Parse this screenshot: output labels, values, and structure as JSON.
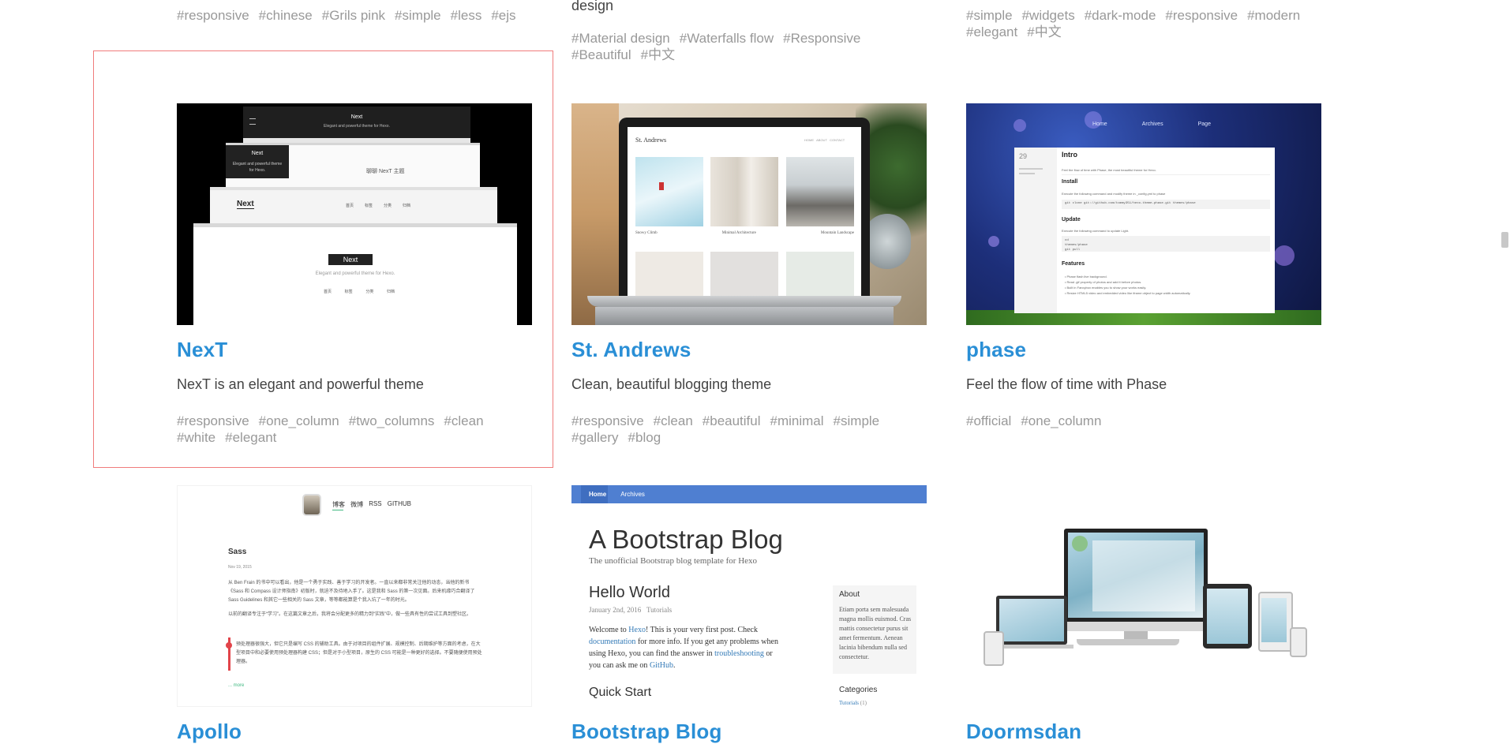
{
  "top_row": {
    "col1_tags": [
      "#responsive",
      "#chinese",
      "#Grils pink",
      "#simple",
      "#less",
      "#ejs"
    ],
    "col2_desc_tail": "design",
    "col2_tags_line1": [
      "#Material design",
      "#Waterfalls flow",
      "#Responsive"
    ],
    "col2_tags_line2": [
      "#Beautiful",
      "#中文"
    ],
    "col3_tags_line1": [
      "#simple",
      "#widgets",
      "#dark-mode",
      "#responsive",
      "#modern"
    ],
    "col3_tags_line2": [
      "#elegant",
      "#中文"
    ]
  },
  "cards": [
    {
      "title": "NexT",
      "desc": "NexT is an elegant and powerful theme",
      "tags_line1": [
        "#responsive",
        "#one_column",
        "#two_columns",
        "#clean"
      ],
      "tags_line2": [
        "#white",
        "#elegant"
      ],
      "shot": {
        "top_title": "Next",
        "top_sub": "Elegant and powerful theme for Hexo.",
        "mid_title": "Next",
        "mid_sub": "Elegant and powerful theme for Hexo.",
        "mid_cn": "聊聊 NexT 主题",
        "nav_logo": "Next",
        "nav_items": [
          "首页",
          "标签",
          "分类",
          "归档"
        ],
        "front_title": "Next",
        "front_sub": "Elegant and powerful theme for Hexo.",
        "front_nav": [
          "首页",
          "标签",
          "分类",
          "归档"
        ]
      }
    },
    {
      "title": "St. Andrews",
      "desc": "Clean, beautiful blogging theme",
      "tags_line1": [
        "#responsive",
        "#clean",
        "#beautiful",
        "#minimal",
        "#simple"
      ],
      "tags_line2": [
        "#gallery",
        "#blog"
      ],
      "shot": {
        "site": "St. Andrews",
        "nav": "HOME   ABOUT   CONTACT",
        "captions": [
          "Snowy Climb",
          "Minimal Architecture",
          "Mountain Landscape"
        ]
      }
    },
    {
      "title": "phase",
      "desc": "Feel the flow of time with Phase",
      "tags_line1": [
        "#official",
        "#one_column"
      ],
      "tags_line2": [],
      "shot": {
        "nav": [
          "Home",
          "Archives",
          "Page"
        ],
        "date": "29",
        "h_intro": "Intro",
        "intro_text": "Feel the flow of time with Phase, the most beautiful theme for Hexo.",
        "h_install": "Install",
        "install_text": "Execute the following command and modify theme in _config.yml to phase",
        "install_cmd": "git clone git://github.com/tommy351/hexo-theme-phase.git themes/phase",
        "h_update": "Update",
        "update_text": "Execute the following command to update Light.",
        "update_cmd": "cd themes/phase  git pull",
        "h_features": "Features",
        "features": [
          "Phase flash live background.",
          "Read .gif property of photos and add it before photos.",
          "Built in Fancybox enables you to show your works easily.",
          "Resize HTML5 video and embedded video like iframe object to page width automatically."
        ]
      }
    }
  ],
  "bottom": [
    {
      "title": "Apollo",
      "shot": {
        "nav": [
          "博客",
          "微博",
          "RSS",
          "GITHUB"
        ],
        "post_title": "Sass",
        "post_date": "Nov 19, 2015",
        "p1": "从 Ben Frain 的书中可以看出，他是一个勇于实践、善于学习的开发者。一直以来都非常关注他的动态，当他的新书《Sass 和 Compass 设计师指南》初版时，就迫不及待地入手了。这是我和 Sass 的第一次见面。后来机缘巧合翻译了 Sass Guidelines 和其它一些相关的 Sass 文章，等等都能算是个我入坑了一年的时光。",
        "p2": "以前的翻译专注于“学习”。在这篇文章之后，我将会分配更多的精力到“实践”中，做一些具有性的尝试工具到塑社区。",
        "quote": "预处理器很强大，但它只是编写 CSS 的辅助工具。由于对项目的组件扩展、规模控制、后期维护等方面的考虑，在大型项目中和必要使用预处理器构建 CSS；但是对于小型项目，原生的 CSS 可能是一种更好的选择。不要随便使用预处理器。",
        "more": "... more"
      }
    },
    {
      "title": "Bootstrap Blog",
      "shot": {
        "nav": [
          "Home",
          "Archives"
        ],
        "blog_title": "A Bootstrap Blog",
        "blog_sub": "The unofficial Bootstrap blog template for Hexo",
        "post_title": "Hello World",
        "post_date": "January 2nd, 2016",
        "post_cat": "Tutorials",
        "text1": "Welcome to",
        "text_link1": "Hexo",
        "text2": "! This is your very first post. Check",
        "text_link2": "documentation",
        "text3": "for more info. If you get any problems when using Hexo, you can find the answer in",
        "text_link3": "troubleshooting",
        "text4": "or you can ask me on",
        "text_link4": "GitHub",
        "h2": "Quick Start",
        "about_title": "About",
        "about_text": "Etiam porta sem malesuada magna mollis euismod. Cras mattis consectetur purus sit amet fermentum. Aenean lacinia bibendum nulla sed consectetur.",
        "cat_title": "Categories",
        "cat_item": "Tutorials",
        "cat_count": "(1)"
      }
    },
    {
      "title": "Doormsdan",
      "shot": {}
    }
  ],
  "colors": {
    "link": "#2a8fd6",
    "tag": "#999999",
    "highlight_border": "#f07c7c"
  }
}
